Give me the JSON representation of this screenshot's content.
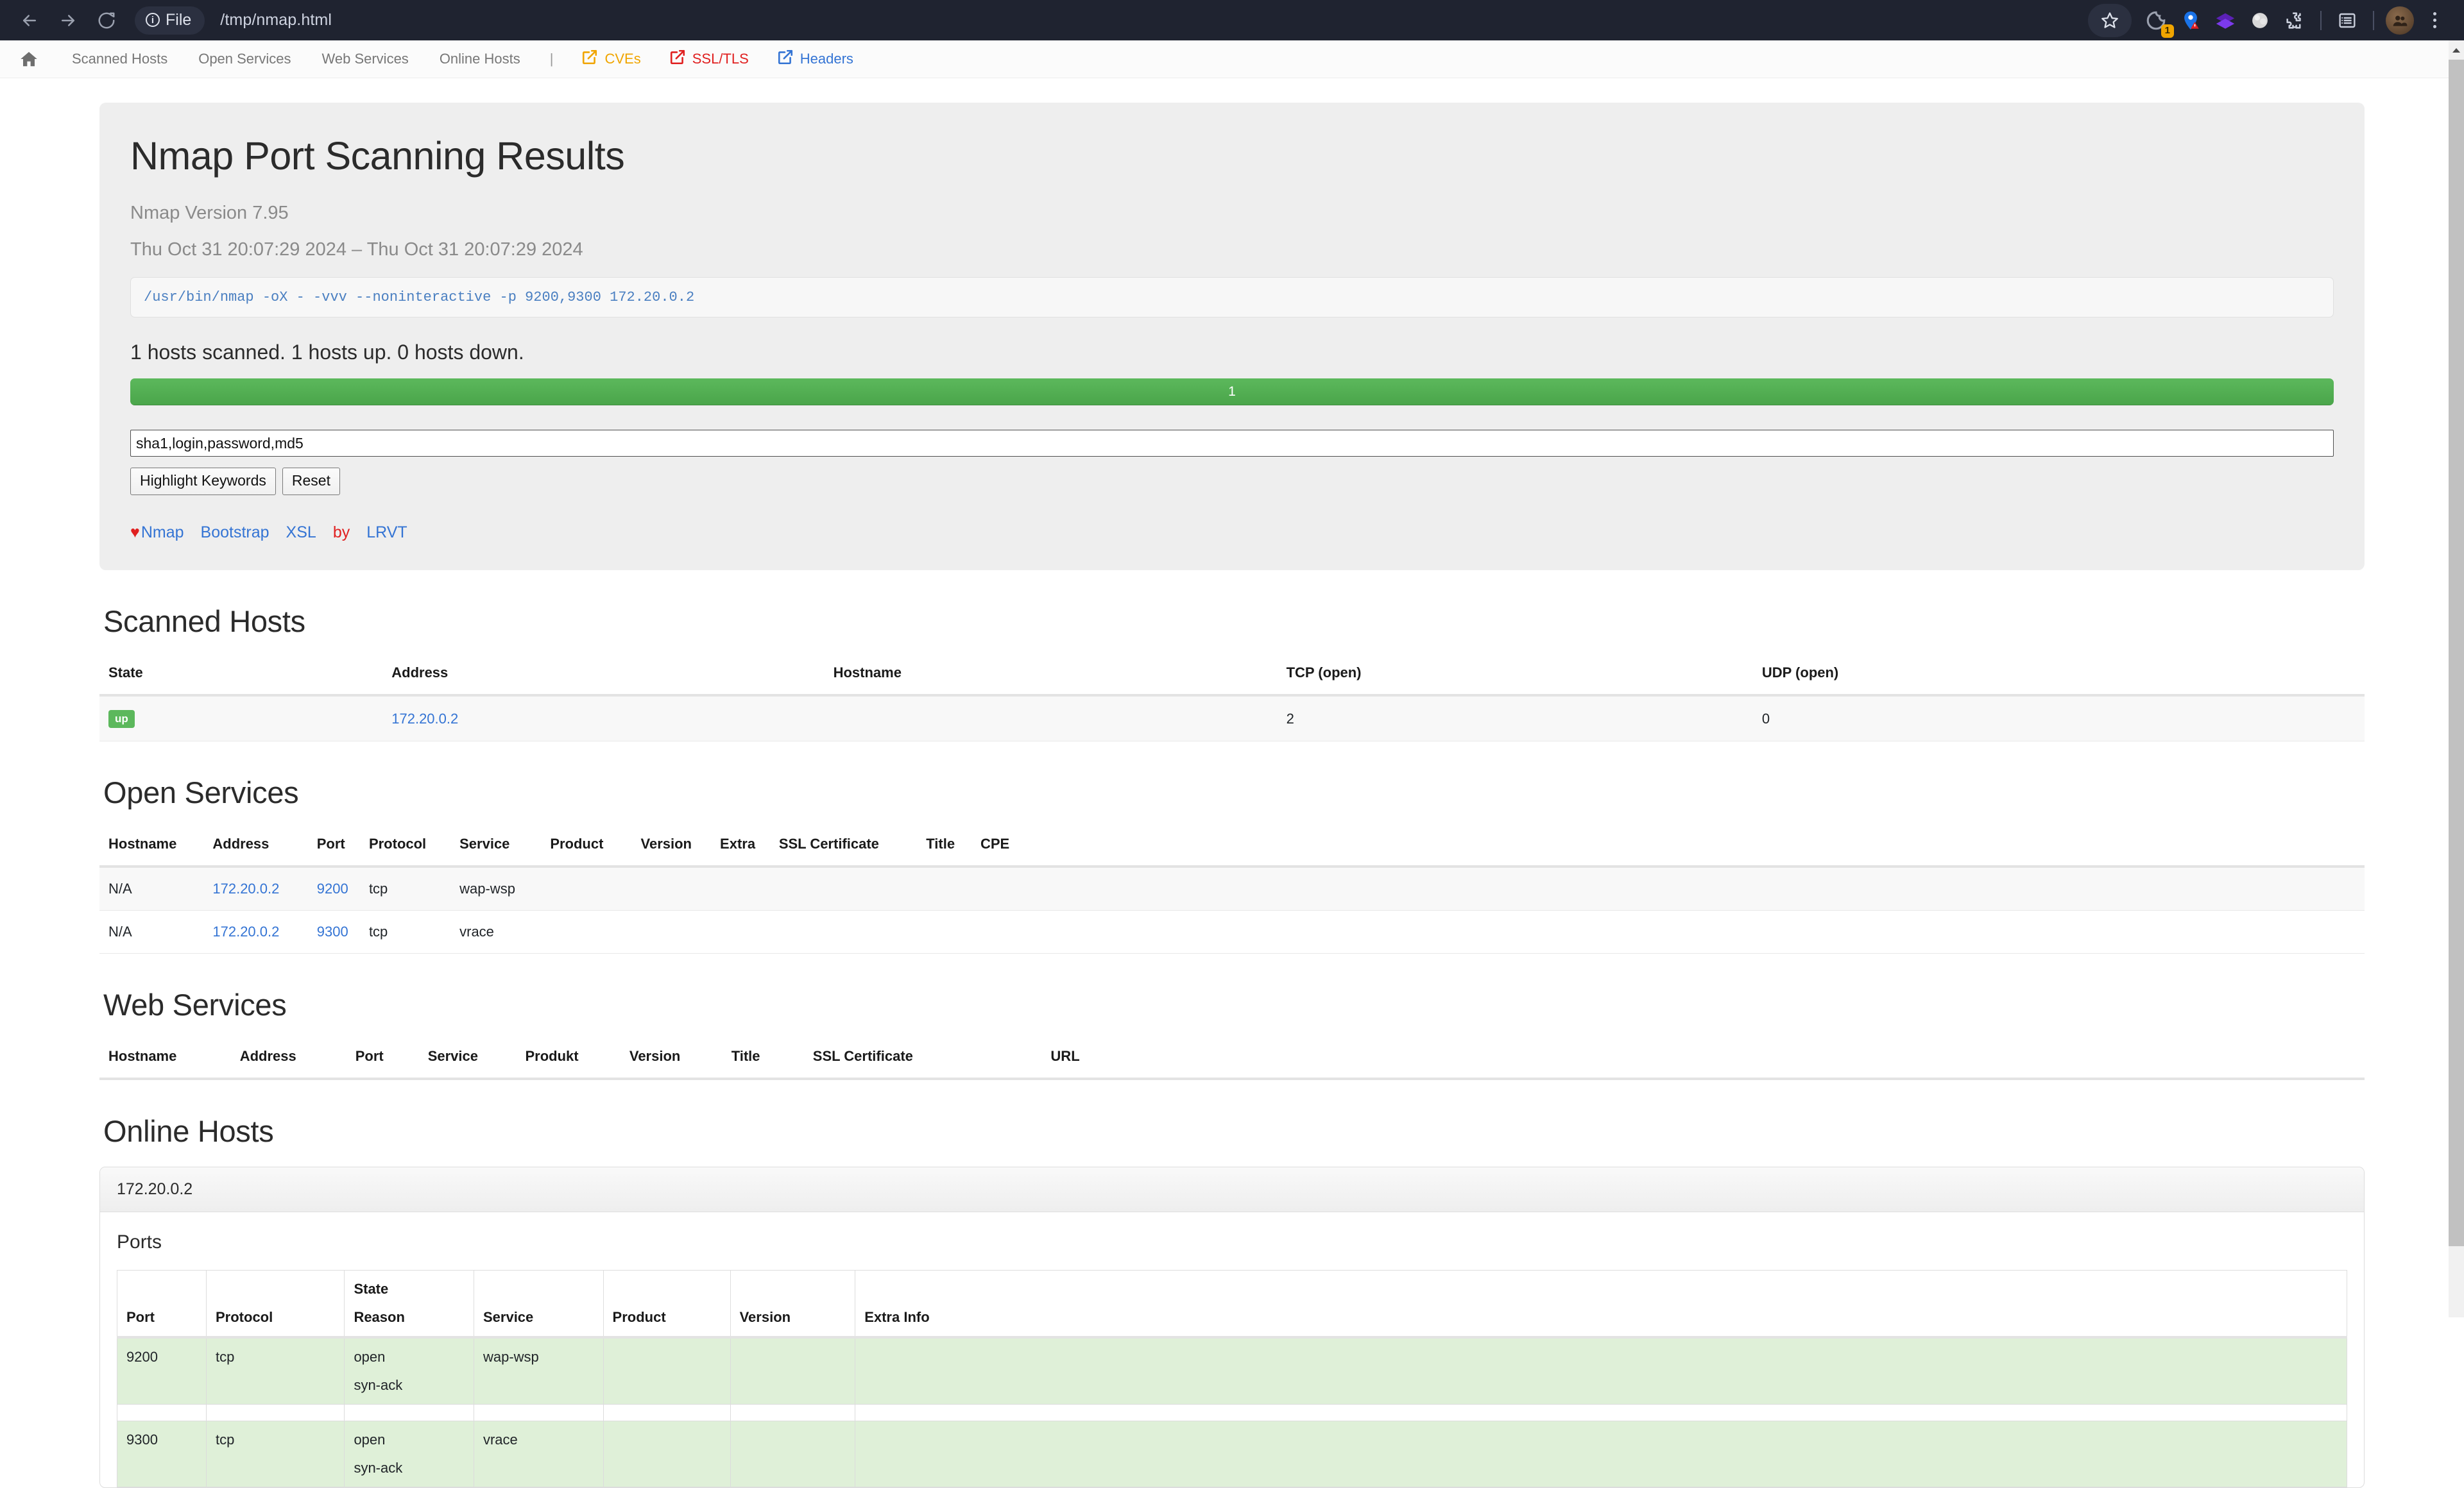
{
  "browser": {
    "back_icon": "back-arrow-icon",
    "forward_icon": "forward-arrow-icon",
    "reload_icon": "reload-icon",
    "file_chip_label": "File",
    "url": "/tmp/nmap.html",
    "bookmark_icon": "star-icon",
    "extension_badge_count": "1",
    "toolbar_icons": [
      "cookie-blocker-icon",
      "location-warning-icon",
      "layers-icon",
      "lens-icon",
      "puzzle-extensions-icon",
      "reading-list-icon"
    ],
    "avatar_icon": "profile-avatar",
    "menu_icon": "kebab-menu-icon"
  },
  "page_nav": {
    "home_icon": "home-icon",
    "links": [
      {
        "label": "Scanned Hosts"
      },
      {
        "label": "Open Services"
      },
      {
        "label": "Web Services"
      },
      {
        "label": "Online Hosts"
      }
    ],
    "separator": "|",
    "external": [
      {
        "label": "CVEs",
        "color": "#f0a500",
        "icon": "external-link-icon"
      },
      {
        "label": "SSL/TLS",
        "color": "#e02020",
        "icon": "external-link-icon"
      },
      {
        "label": "Headers",
        "color": "#3474d4",
        "icon": "external-link-icon"
      }
    ]
  },
  "jumbotron": {
    "title": "Nmap Port Scanning Results",
    "version": "Nmap Version 7.95",
    "timerange": "Thu Oct 31 20:07:29 2024 – Thu Oct 31 20:07:29 2024",
    "command": "/usr/bin/nmap -oX - -vvv --noninteractive -p 9200,9300 172.20.0.2",
    "summary": "1 hosts scanned. 1 hosts up. 0 hosts down.",
    "progress": {
      "label": "1",
      "percent": 100,
      "color": "#5cb85c"
    },
    "keywords_value": "sha1,login,password,md5",
    "keywords_placeholder": "",
    "highlight_button": "Highlight Keywords",
    "reset_button": "Reset",
    "footer": {
      "heart": "♥",
      "links": [
        "Nmap",
        "Bootstrap",
        "XSL"
      ],
      "by": "by",
      "author": "LRVT"
    }
  },
  "scanned_hosts": {
    "title": "Scanned Hosts",
    "columns": [
      "State",
      "Address",
      "Hostname",
      "TCP (open)",
      "UDP (open)"
    ],
    "rows": [
      {
        "state": "up",
        "address": "172.20.0.2",
        "hostname": "",
        "tcp_open": "2",
        "udp_open": "0"
      }
    ]
  },
  "open_services": {
    "title": "Open Services",
    "columns": [
      "Hostname",
      "Address",
      "Port",
      "Protocol",
      "Service",
      "Product",
      "Version",
      "Extra",
      "SSL Certificate",
      "Title",
      "CPE"
    ],
    "rows": [
      {
        "hostname": "N/A",
        "address": "172.20.0.2",
        "port": "9200",
        "protocol": "tcp",
        "service": "wap-wsp",
        "product": "",
        "version": "",
        "extra": "",
        "ssl": "",
        "title": "",
        "cpe": ""
      },
      {
        "hostname": "N/A",
        "address": "172.20.0.2",
        "port": "9300",
        "protocol": "tcp",
        "service": "vrace",
        "product": "",
        "version": "",
        "extra": "",
        "ssl": "",
        "title": "",
        "cpe": ""
      }
    ]
  },
  "web_services": {
    "title": "Web Services",
    "columns": [
      "Hostname",
      "Address",
      "Port",
      "Service",
      "Produkt",
      "Version",
      "Title",
      "SSL Certificate",
      "URL"
    ],
    "rows": []
  },
  "online_hosts": {
    "title": "Online Hosts",
    "host": "172.20.0.2",
    "ports_title": "Ports",
    "columns": [
      "Port",
      "Protocol",
      "State\nReason",
      "Service",
      "Product",
      "Version",
      "Extra Info"
    ],
    "column_state_line1": "State",
    "column_state_line2": "Reason",
    "rows": [
      {
        "port": "9200",
        "protocol": "tcp",
        "state": "open",
        "reason": "syn-ack",
        "service": "wap-wsp",
        "product": "",
        "version": "",
        "extra_info": ""
      },
      {
        "port": "9300",
        "protocol": "tcp",
        "state": "open",
        "reason": "syn-ack",
        "service": "vrace",
        "product": "",
        "version": "",
        "extra_info": ""
      }
    ]
  }
}
